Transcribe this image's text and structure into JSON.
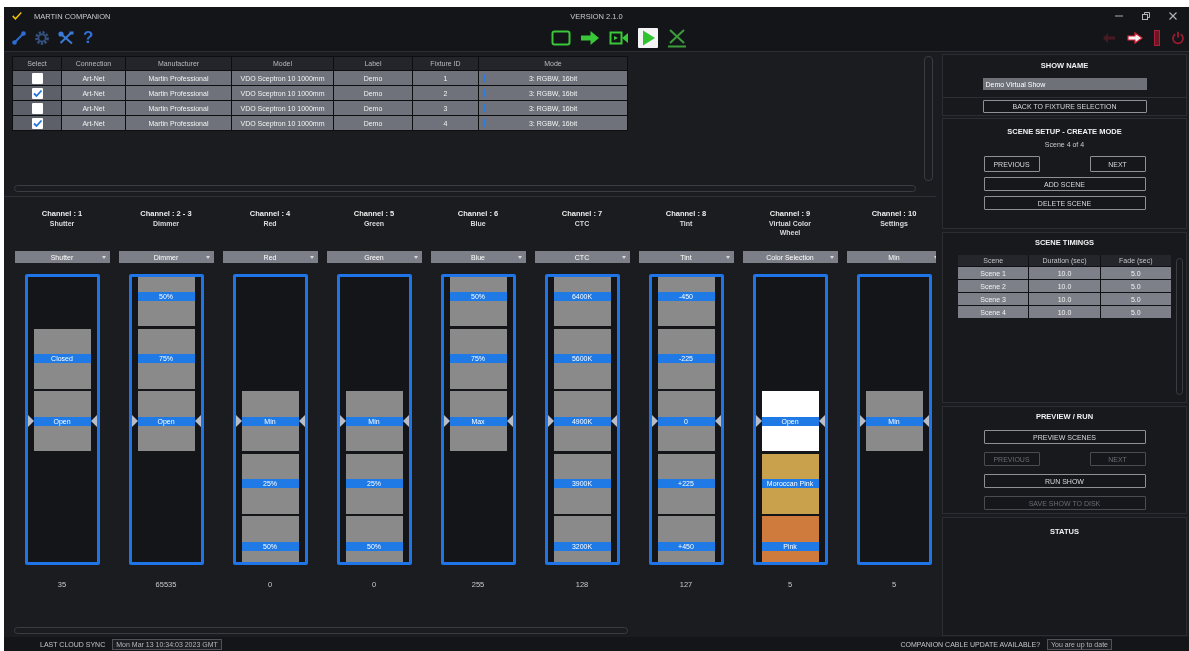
{
  "window": {
    "title": "MARTIN COMPANION",
    "version": "VERSION 2.1.0"
  },
  "toolbar": {
    "help": "?",
    "run_tools": [
      {
        "selected": false
      },
      {
        "selected": false
      },
      {
        "selected": false
      },
      {
        "selected": true
      },
      {
        "selected": false
      }
    ]
  },
  "fixtures": {
    "columns": [
      "Select",
      "Connection",
      "Manufacturer",
      "Model",
      "Label",
      "Fixture ID",
      "Mode"
    ],
    "rows": [
      {
        "checked": false,
        "connection": "Art-Net",
        "manufacturer": "Martin Professional",
        "model": "VDO Sceptron 10 1000mm",
        "label": "Demo",
        "fixture_id": "1",
        "mode": "3: RGBW, 16bit"
      },
      {
        "checked": true,
        "connection": "Art-Net",
        "manufacturer": "Martin Professional",
        "model": "VDO Sceptron 10 1000mm",
        "label": "Demo",
        "fixture_id": "2",
        "mode": "3: RGBW, 16bit"
      },
      {
        "checked": false,
        "connection": "Art-Net",
        "manufacturer": "Martin Professional",
        "model": "VDO Sceptron 10 1000mm",
        "label": "Demo",
        "fixture_id": "3",
        "mode": "3: RGBW, 16bit"
      },
      {
        "checked": true,
        "connection": "Art-Net",
        "manufacturer": "Martin Professional",
        "model": "VDO Sceptron 10 1000mm",
        "label": "Demo",
        "fixture_id": "4",
        "mode": "3: RGBW, 16bit"
      }
    ]
  },
  "channels": [
    {
      "title": "Channel : 1",
      "function": "Shutter",
      "dropdown": "Shutter",
      "slots": [
        {
          "kind": "blank"
        },
        {
          "kind": "stop",
          "label": "Closed"
        },
        {
          "kind": "stop",
          "label": "Open"
        },
        {
          "kind": "blank"
        },
        {
          "kind": "blank"
        }
      ],
      "reading": "35"
    },
    {
      "title": "Channel : 2 - 3",
      "function": "Dimmer",
      "dropdown": "Dimmer",
      "slots": [
        {
          "kind": "stop",
          "label": "50%"
        },
        {
          "kind": "stop",
          "label": "75%"
        },
        {
          "kind": "stop",
          "label": "Open"
        },
        {
          "kind": "blank"
        },
        {
          "kind": "blank"
        }
      ],
      "reading": "65535"
    },
    {
      "title": "Channel : 4",
      "function": "Red",
      "dropdown": "Red",
      "slots": [
        {
          "kind": "blank"
        },
        {
          "kind": "blank"
        },
        {
          "kind": "stop",
          "label": "Min"
        },
        {
          "kind": "stop",
          "label": "25%"
        },
        {
          "kind": "stop",
          "label": "50%"
        }
      ],
      "reading": "0"
    },
    {
      "title": "Channel : 5",
      "function": "Green",
      "dropdown": "Green",
      "slots": [
        {
          "kind": "blank"
        },
        {
          "kind": "blank"
        },
        {
          "kind": "stop",
          "label": "Min"
        },
        {
          "kind": "stop",
          "label": "25%"
        },
        {
          "kind": "stop",
          "label": "50%"
        }
      ],
      "reading": "0"
    },
    {
      "title": "Channel : 6",
      "function": "Blue",
      "dropdown": "Blue",
      "slots": [
        {
          "kind": "stop",
          "label": "50%"
        },
        {
          "kind": "stop",
          "label": "75%"
        },
        {
          "kind": "stop",
          "label": "Max"
        },
        {
          "kind": "blank"
        },
        {
          "kind": "blank"
        }
      ],
      "reading": "255"
    },
    {
      "title": "Channel : 7",
      "function": "CTC",
      "dropdown": "CTC",
      "slots": [
        {
          "kind": "stop",
          "label": "6400K"
        },
        {
          "kind": "stop",
          "label": "5600K"
        },
        {
          "kind": "stop",
          "label": "4900K"
        },
        {
          "kind": "stop",
          "label": "3900K"
        },
        {
          "kind": "stop",
          "label": "3200K"
        }
      ],
      "reading": "128"
    },
    {
      "title": "Channel : 8",
      "function": "Tint",
      "dropdown": "Tint",
      "slots": [
        {
          "kind": "stop",
          "label": "-450"
        },
        {
          "kind": "stop",
          "label": "-225"
        },
        {
          "kind": "stop",
          "label": "0"
        },
        {
          "kind": "stop",
          "label": "+225"
        },
        {
          "kind": "stop",
          "label": "+450"
        }
      ],
      "reading": "127"
    },
    {
      "title": "Channel : 9",
      "function": "Virtual Color Wheel",
      "dropdown": "Color Selection",
      "slots": [
        {
          "kind": "blank"
        },
        {
          "kind": "blank"
        },
        {
          "kind": "stop",
          "label": "Open",
          "color": "#ffffff"
        },
        {
          "kind": "stop",
          "label": "Moroccan Pink",
          "color": "#c9a04c"
        },
        {
          "kind": "stop",
          "label": "Pink",
          "color": "#cf7b3e"
        }
      ],
      "reading": "5"
    },
    {
      "title": "Channel : 10",
      "function": "Settings",
      "dropdown": "Min",
      "slots": [
        {
          "kind": "blank"
        },
        {
          "kind": "blank"
        },
        {
          "kind": "stop",
          "label": "Min"
        },
        {
          "kind": "blank"
        },
        {
          "kind": "blank"
        }
      ],
      "reading": "5"
    }
  ],
  "show_name": {
    "title": "SHOW NAME",
    "value": "Demo Virtual Show",
    "back_button": "BACK TO FIXTURE SELECTION"
  },
  "scene_setup": {
    "title": "SCENE SETUP - CREATE MODE",
    "counter": "Scene 4 of 4",
    "buttons": [
      {
        "label": "PREVIOUS",
        "kind": "half",
        "disabled": false
      },
      {
        "label": "NEXT",
        "kind": "half",
        "disabled": false
      },
      {
        "label": "ADD SCENE",
        "kind": "full",
        "disabled": false
      },
      {
        "label": "DELETE SCENE",
        "kind": "full",
        "disabled": false
      }
    ]
  },
  "scene_timings": {
    "title": "SCENE TIMINGS",
    "columns": [
      "Scene",
      "Duration (sec)",
      "Fade (sec)"
    ],
    "rows": [
      [
        "Scene 1",
        "10.0",
        "5.0"
      ],
      [
        "Scene 2",
        "10.0",
        "5.0"
      ],
      [
        "Scene 3",
        "10.0",
        "5.0"
      ],
      [
        "Scene 4",
        "10.0",
        "5.0"
      ]
    ]
  },
  "preview_run": {
    "title": "PREVIEW / RUN",
    "buttons": [
      {
        "label": "PREVIEW SCENES",
        "kind": "full",
        "disabled": false
      },
      {
        "label": "PREVIOUS",
        "kind": "half",
        "disabled": true
      },
      {
        "label": "NEXT",
        "kind": "half",
        "disabled": true
      },
      {
        "label": "RUN SHOW",
        "kind": "full",
        "disabled": false
      },
      {
        "label": "SAVE SHOW TO DISK",
        "kind": "full",
        "disabled": true
      }
    ]
  },
  "status": {
    "title": "STATUS"
  },
  "status_bar": {
    "sync_label": "LAST CLOUD SYNC",
    "sync_value": "Mon Mar 13 10:34:03 2023 GMT",
    "update_label": "COMPANION CABLE UPDATE AVAILABLE?",
    "update_value": "You are up to date"
  }
}
